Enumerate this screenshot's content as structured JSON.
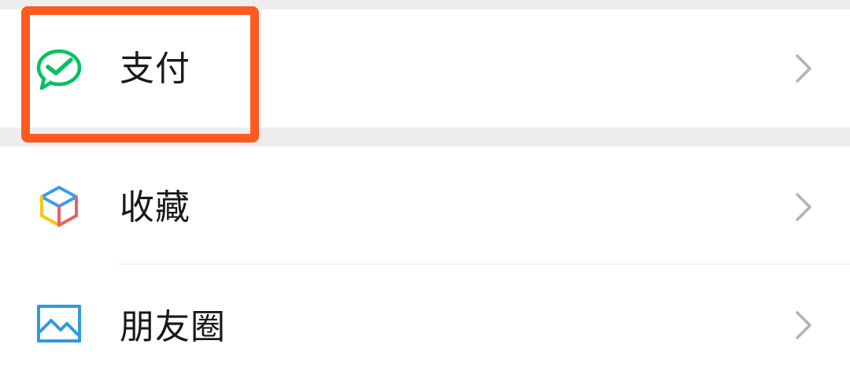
{
  "menu": {
    "items": [
      {
        "label": "支付",
        "icon": "wechat-pay-icon"
      },
      {
        "label": "收藏",
        "icon": "favorites-cube-icon"
      },
      {
        "label": "朋友圈",
        "icon": "moments-image-icon"
      }
    ]
  },
  "colors": {
    "highlight": "#ff5a1f",
    "pay_green": "#07c160",
    "chevron": "#b2b2b2",
    "background": "#ededed",
    "row_background": "#ffffff"
  }
}
